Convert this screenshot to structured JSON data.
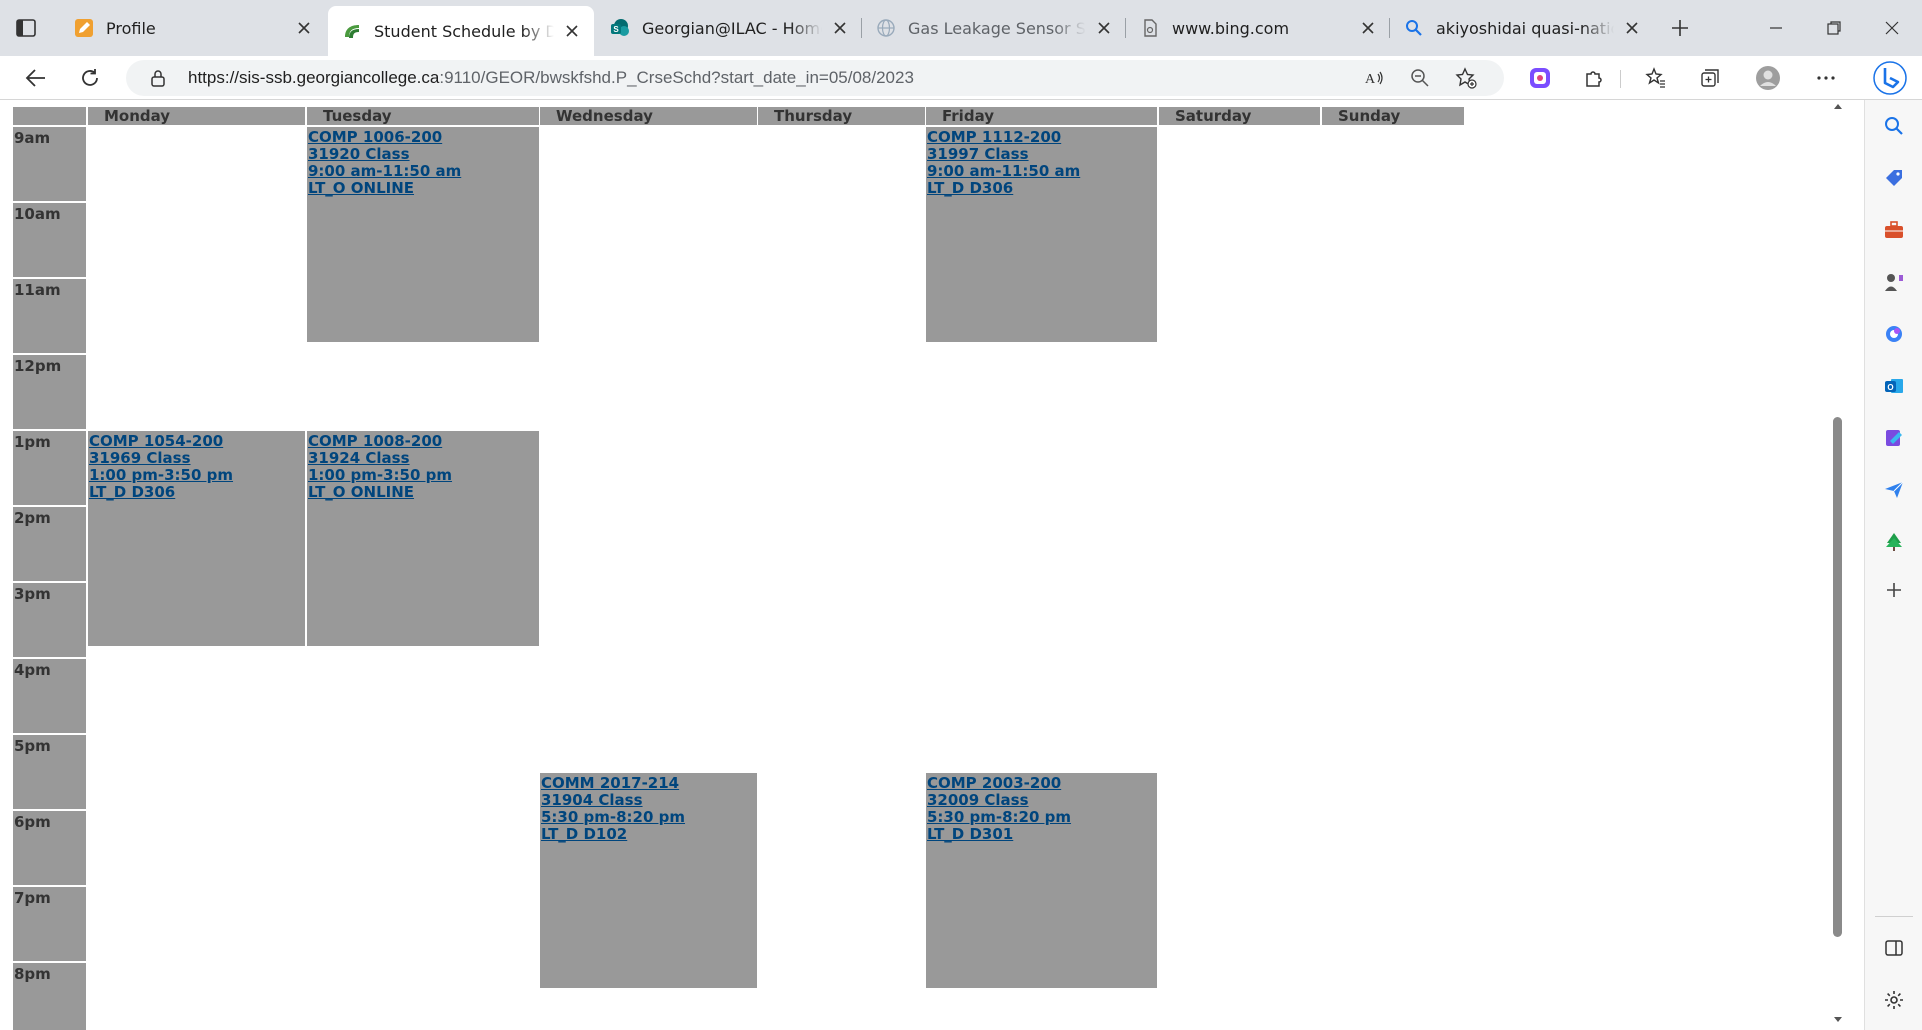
{
  "browser": {
    "tabs": [
      {
        "title": "Profile",
        "favicon": "pencil-icon"
      },
      {
        "title": "Student Schedule by Day and Time",
        "favicon": "banner-icon"
      },
      {
        "title": "Georgian@ILAC - Home",
        "favicon": "sharepoint-icon"
      },
      {
        "title": "Gas Leakage Sensor Solution",
        "favicon": "globe-icon"
      },
      {
        "title": "www.bing.com",
        "favicon": "page-icon"
      },
      {
        "title": "akiyoshidai quasi-national park",
        "favicon": "search-icon"
      }
    ],
    "url_host": "https://sis-ssb.georgiancollege.ca",
    "url_rest": ":9110/GEOR/bwskfshd.P_CrseSchd?start_date_in=05/08/2023"
  },
  "schedule": {
    "days": [
      "Monday",
      "Tuesday",
      "Wednesday",
      "Thursday",
      "Friday",
      "Saturday",
      "Sunday"
    ],
    "times": [
      "9am",
      "10am",
      "11am",
      "12pm",
      "1pm",
      "2pm",
      "3pm",
      "4pm",
      "5pm",
      "6pm",
      "7pm",
      "8pm"
    ],
    "events": [
      {
        "course": "COMP 1006-200",
        "crn": "31920 Class",
        "time": "9:00 am-11:50 am",
        "room": "LT_O ONLINE",
        "day": "Tuesday",
        "start": 9.0,
        "end": 11.833
      },
      {
        "course": "COMP 1112-200",
        "crn": "31997 Class",
        "time": "9:00 am-11:50 am",
        "room": "LT_D D306",
        "day": "Friday",
        "start": 9.0,
        "end": 11.833
      },
      {
        "course": "COMP 1054-200",
        "crn": "31969 Class",
        "time": "1:00 pm-3:50 pm",
        "room": "LT_D D306",
        "day": "Monday",
        "start": 13.0,
        "end": 15.833
      },
      {
        "course": "COMP 1008-200",
        "crn": "31924 Class",
        "time": "1:00 pm-3:50 pm",
        "room": "LT_O ONLINE",
        "day": "Tuesday",
        "start": 13.0,
        "end": 15.833
      },
      {
        "course": "COMM 2017-214",
        "crn": "31904 Class",
        "time": "5:30 pm-8:20 pm",
        "room": "LT_D D102",
        "day": "Wednesday",
        "start": 17.5,
        "end": 20.333
      },
      {
        "course": "COMP 2003-200",
        "crn": "32009 Class",
        "time": "5:30 pm-8:20 pm",
        "room": "LT_D D301",
        "day": "Friday",
        "start": 17.5,
        "end": 20.333
      }
    ]
  },
  "colors": {
    "cell": "#999999",
    "link": "#00457d",
    "header_text": "#333333"
  }
}
